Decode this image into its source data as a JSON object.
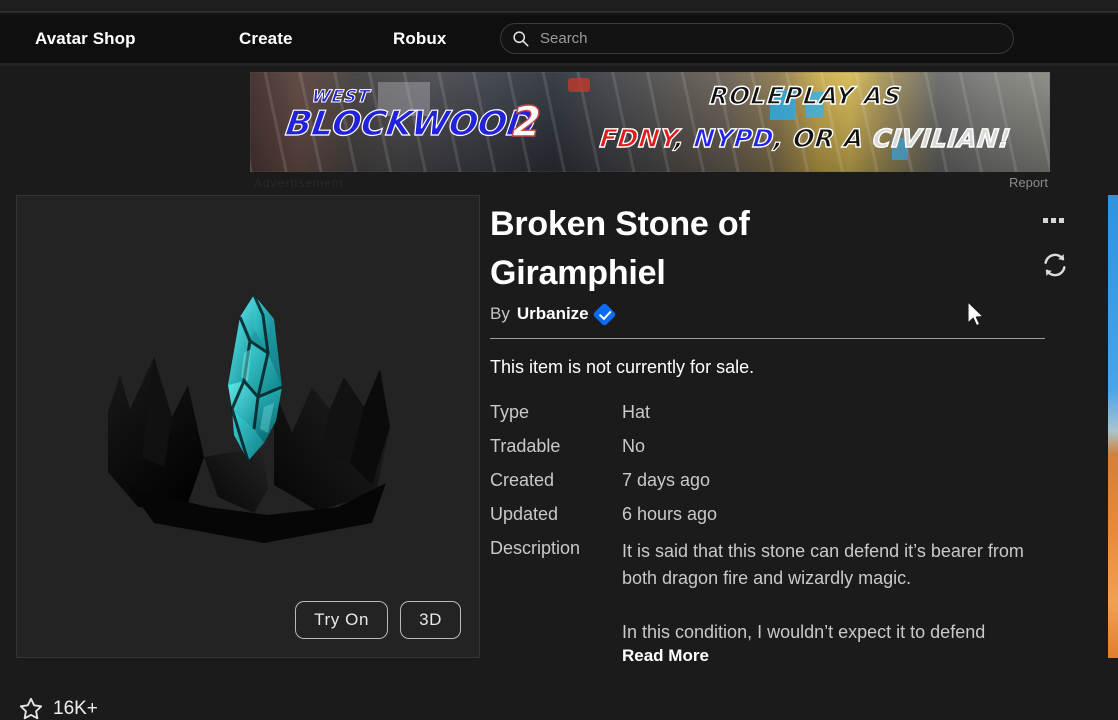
{
  "nav": {
    "links": [
      {
        "label": "Avatar Shop",
        "name": "nav-avatar-shop"
      },
      {
        "label": "Create",
        "name": "nav-create"
      },
      {
        "label": "Robux",
        "name": "nav-robux"
      }
    ],
    "search": {
      "placeholder": "Search",
      "value": "",
      "icon": "search-icon"
    }
  },
  "ad": {
    "west": "WEST",
    "blockwood": "BLOCKWOOD",
    "two": "2",
    "roleplay": "ROLEPLAY AS",
    "fdny": "FDNY",
    "comma1": ",",
    "nypd": "NYPD",
    "comma2": ", ",
    "or_a": "OR A",
    "civilian": "CIVILIAN!",
    "advertisement_label": "Advertisement",
    "report_label": "Report"
  },
  "thumbnail": {
    "alt": "Broken Stone of Giramphiel crown with teal crystal",
    "gem_color": "#1d9aa3",
    "crown_color": "#0a0a0a",
    "try_on_label": "Try On",
    "three_d_label": "3D"
  },
  "favorites": {
    "icon": "star-icon",
    "count": "16K+"
  },
  "item": {
    "title": "Broken Stone of Giramphiel",
    "by_label": "By",
    "creator": "Urbanize",
    "verified": true,
    "sale_status": "This item is not currently for sale.",
    "specs": [
      {
        "key": "Type",
        "value": "Hat"
      },
      {
        "key": "Tradable",
        "value": "No"
      },
      {
        "key": "Created",
        "value": "7 days ago"
      },
      {
        "key": "Updated",
        "value": "6 hours ago"
      }
    ],
    "description_label": "Description",
    "description_p1": "It is said that this stone can defend it’s bearer from both dragon fire and wizardly magic.",
    "description_p2": "In this condition, I wouldn’t expect it to defend",
    "read_more_label": "Read More"
  },
  "actions": {
    "more_icon": "ellipsis-icon",
    "refresh_icon": "refresh-icon"
  },
  "colors": {
    "page_bg": "#1b1b1b",
    "panel_bg": "#232323",
    "nav_bg": "#0f0f0f",
    "accent_blue": "#0b6bf2",
    "text_primary": "#ffffff",
    "text_secondary": "#c9c9c9"
  }
}
